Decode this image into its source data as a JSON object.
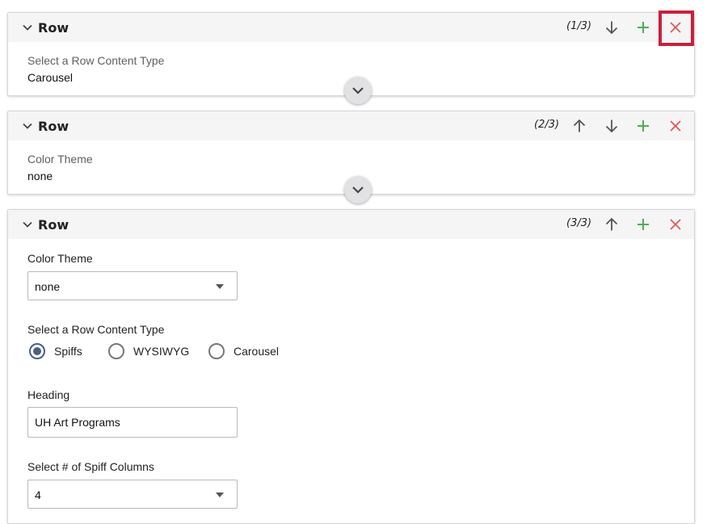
{
  "colors": {
    "remove": "#e0575a",
    "add": "#4caf50",
    "arrow": "#555555",
    "highlight": "#cc1f3b",
    "radio_checked": "#4a5f82"
  },
  "rows": [
    {
      "title": "Row",
      "counter": "(1/3)",
      "summary_label": "Select a Row Content Type",
      "summary_value": "Carousel"
    },
    {
      "title": "Row",
      "counter": "(2/3)",
      "summary_label": "Color Theme",
      "summary_value": "none"
    },
    {
      "title": "Row",
      "counter": "(3/3)",
      "color_theme": {
        "label": "Color Theme",
        "value": "none"
      },
      "content_type": {
        "label": "Select a Row Content Type",
        "options": [
          "Spiffs",
          "WYSIWYG",
          "Carousel"
        ],
        "selected": "Spiffs"
      },
      "heading": {
        "label": "Heading",
        "value": "UH Art Programs"
      },
      "spiff_columns": {
        "label": "Select # of Spiff Columns",
        "value": "4"
      }
    }
  ]
}
